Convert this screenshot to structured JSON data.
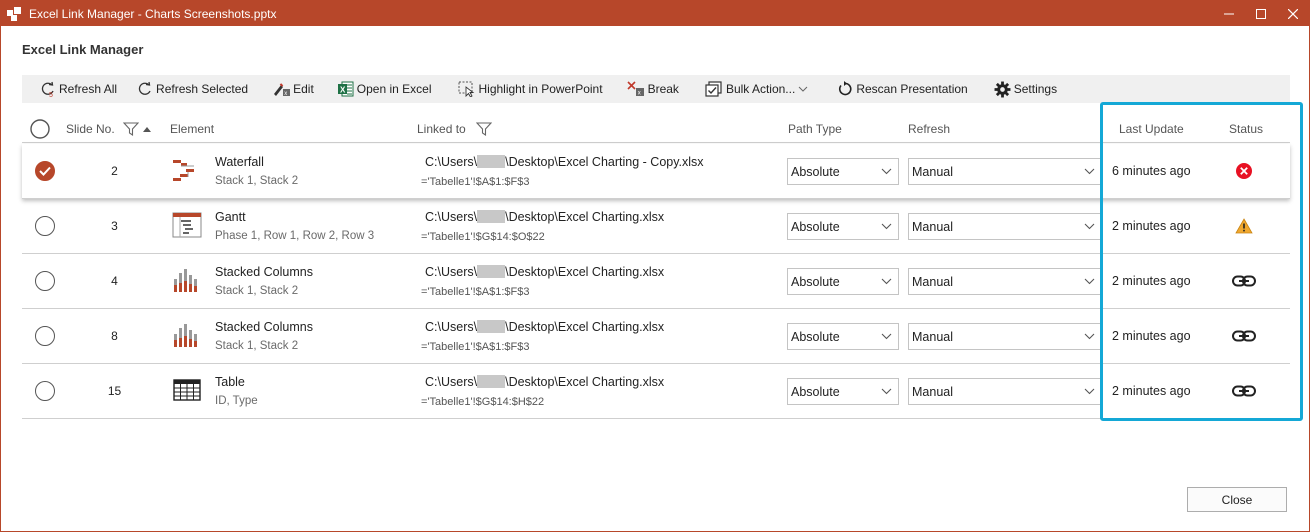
{
  "window": {
    "title": "Excel Link Manager - Charts Screenshots.pptx",
    "controls": {
      "minimize": "—",
      "maximize": "☐",
      "close": "✕"
    },
    "accent_color": "#b7472a"
  },
  "dialog": {
    "heading": "Excel Link Manager"
  },
  "toolbar": {
    "refresh_all": "Refresh All",
    "refresh_selected": "Refresh Selected",
    "edit": "Edit",
    "open_in_excel": "Open in Excel",
    "highlight": "Highlight in PowerPoint",
    "break": "Break",
    "bulk_actions": "Bulk Action...",
    "rescan": "Rescan Presentation",
    "settings": "Settings"
  },
  "columns": {
    "slide_no": "Slide No.",
    "element": "Element",
    "linked_to": "Linked to",
    "path_type": "Path Type",
    "refresh": "Refresh",
    "last_update": "Last Update",
    "status": "Status"
  },
  "rows": [
    {
      "selected": true,
      "slide": "2",
      "icon": "waterfall-chart-icon",
      "name": "Waterfall",
      "sub": "Stack 1, Stack 2",
      "path_prefix": "C:\\Users\\",
      "path_suffix": "\\Desktop\\Excel Charting - Copy.xlsx",
      "range": "='Tabelle1'!$A$1:$F$3",
      "path_type": "Absolute",
      "refresh": "Manual",
      "last_update": "6 minutes ago",
      "status": "error-icon"
    },
    {
      "selected": false,
      "slide": "3",
      "icon": "gantt-chart-icon",
      "name": "Gantt",
      "sub": "Phase 1, Row 1, Row 2, Row 3",
      "path_prefix": "C:\\Users\\",
      "path_suffix": "\\Desktop\\Excel Charting.xlsx",
      "range": "='Tabelle1'!$G$14:$O$22",
      "path_type": "Absolute",
      "refresh": "Manual",
      "last_update": "2 minutes ago",
      "status": "warning-icon"
    },
    {
      "selected": false,
      "slide": "4",
      "icon": "stacked-columns-icon",
      "name": "Stacked Columns",
      "sub": "Stack 1, Stack 2",
      "path_prefix": "C:\\Users\\",
      "path_suffix": "\\Desktop\\Excel Charting.xlsx",
      "range": "='Tabelle1'!$A$1:$F$3",
      "path_type": "Absolute",
      "refresh": "Manual",
      "last_update": "2 minutes ago",
      "status": "link-icon"
    },
    {
      "selected": false,
      "slide": "8",
      "icon": "stacked-columns-icon",
      "name": "Stacked Columns",
      "sub": "Stack 1, Stack 2",
      "path_prefix": "C:\\Users\\",
      "path_suffix": "\\Desktop\\Excel Charting.xlsx",
      "range": "='Tabelle1'!$A$1:$F$3",
      "path_type": "Absolute",
      "refresh": "Manual",
      "last_update": "2 minutes ago",
      "status": "link-icon"
    },
    {
      "selected": false,
      "slide": "15",
      "icon": "table-icon",
      "name": "Table",
      "sub": "ID, Type",
      "path_prefix": "C:\\Users\\",
      "path_suffix": "\\Desktop\\Excel Charting.xlsx",
      "range": "='Tabelle1'!$G$14:$H$22",
      "path_type": "Absolute",
      "refresh": "Manual",
      "last_update": "2 minutes ago",
      "status": "link-icon"
    }
  ],
  "footer": {
    "close_label": "Close"
  },
  "colors": {
    "highlight_frame": "#14a8d6",
    "error": "#e81123",
    "warning": "#f0a830"
  }
}
